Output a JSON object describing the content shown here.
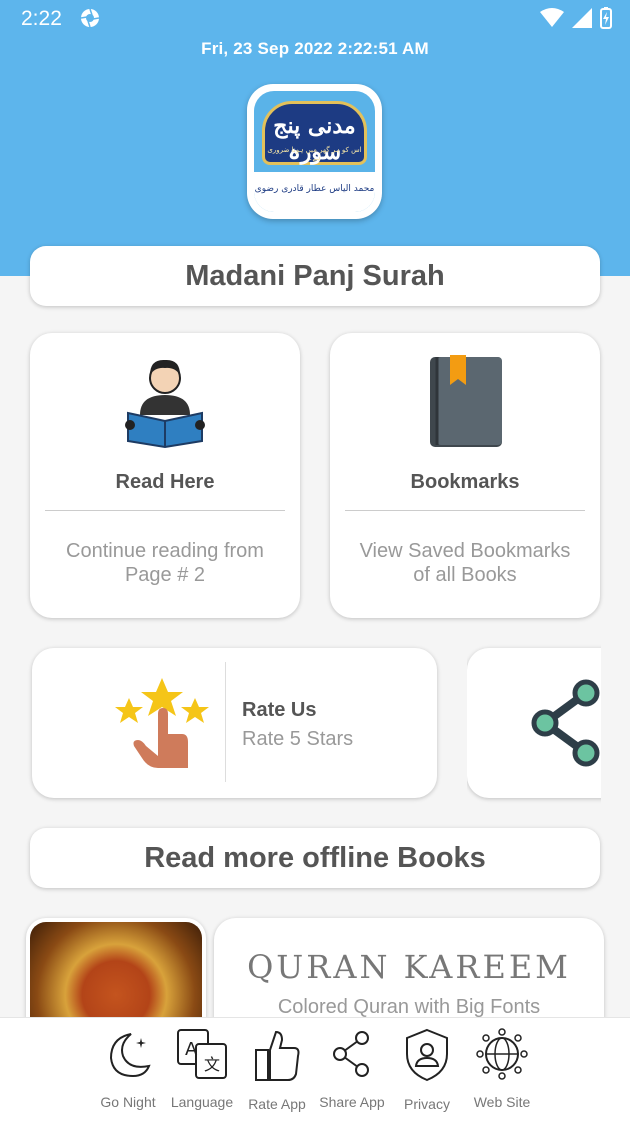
{
  "status_bar": {
    "time": "2:22",
    "icons": [
      "camera-aperture-icon",
      "wifi-icon",
      "signal-icon",
      "battery-charging-icon"
    ]
  },
  "header": {
    "datetime": "Fri, 23  Sep  2022   2:22:51 AM",
    "logo": {
      "title_urdu": "مدنی پنج سورہ",
      "subtitle_urdu": "اس کو ہر گھر میں ہونا ضروری ہے۔",
      "author_urdu": "محمد الیاس عطار قادری رضوی"
    },
    "app_title": "Madani Panj Surah"
  },
  "features": [
    {
      "title": "Read Here",
      "description": "Continue reading from Page # 2",
      "icon": "reading-person-icon"
    },
    {
      "title": "Bookmarks",
      "description": "View Saved Bookmarks of all Books",
      "icon": "bookmark-book-icon"
    }
  ],
  "rate": {
    "title": "Rate Us",
    "subtitle": "Rate 5 Stars",
    "icon": "rate-stars-hand-icon"
  },
  "share_card": {
    "icon": "share-icon"
  },
  "section_title": "Read more offline Books",
  "book": {
    "title": "QURAN  KAREEM",
    "subtitle": "Colored Quran with Big Fonts"
  },
  "bottom_nav": [
    {
      "label": "Go Night",
      "icon": "moon-icon"
    },
    {
      "label": "Language",
      "icon": "translate-icon"
    },
    {
      "label": "Rate App",
      "icon": "thumbs-up-icon"
    },
    {
      "label": "Share App",
      "icon": "share-icon"
    },
    {
      "label": "Privacy",
      "icon": "shield-user-icon"
    },
    {
      "label": "Web Site",
      "icon": "globe-icon"
    }
  ],
  "colors": {
    "header_bg": "#5db5ec",
    "accent_orange": "#f39c12",
    "book_gray": "#5b6770"
  }
}
